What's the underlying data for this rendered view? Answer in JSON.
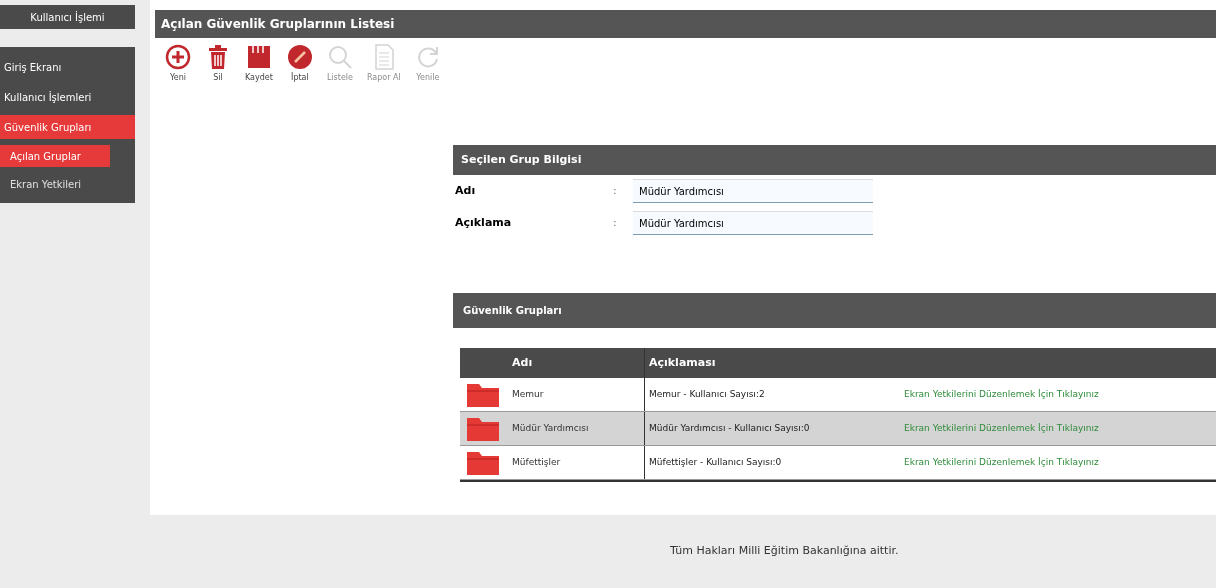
{
  "sidebar": {
    "header": "Kullanıcı İşlemi",
    "items": [
      {
        "label": "Giriş Ekranı",
        "selected": false
      },
      {
        "label": "Kullanıcı İşlemleri",
        "selected": false
      },
      {
        "label": "Güvenlik Grupları",
        "selected": true,
        "children": [
          {
            "label": "Açılan Gruplar",
            "selected": true
          },
          {
            "label": "Ekran Yetkileri",
            "selected": false
          }
        ]
      }
    ]
  },
  "page": {
    "title": "Açılan Güvenlik Gruplarının Listesi"
  },
  "toolbar": [
    {
      "kind": "add",
      "label": "Yeni",
      "disabled": false
    },
    {
      "kind": "delete",
      "label": "Sil",
      "disabled": false
    },
    {
      "kind": "save",
      "label": "Kaydet",
      "disabled": false
    },
    {
      "kind": "cancel",
      "label": "İptal",
      "disabled": false
    },
    {
      "kind": "search",
      "label": "Listele",
      "disabled": true
    },
    {
      "kind": "report",
      "label": "Rapor Al",
      "disabled": true
    },
    {
      "kind": "refresh",
      "label": "Yenile",
      "disabled": true
    }
  ],
  "selected_group": {
    "title": "Seçilen Grup Bilgisi",
    "fields": [
      {
        "label": "Adı",
        "separator": ":",
        "value": "Müdür Yardımcısı"
      },
      {
        "label": "Açıklama",
        "separator": ":",
        "value": "Müdür Yardımcısı"
      }
    ]
  },
  "groups": {
    "title": "Güvenlik Grupları",
    "columns": [
      "Adı",
      "Açıklaması"
    ],
    "rows": [
      {
        "name": "Memur",
        "description": "Memur - Kullanıcı Sayısı:2",
        "link": "Ekran Yetkilerini Düzenlemek İçin Tıklayınız",
        "selected": false
      },
      {
        "name": "Müdür Yardımcısı",
        "description": "Müdür Yardımcısı - Kullanıcı Sayısı:0",
        "link": "Ekran Yetkilerini Düzenlemek İçin Tıklayınız",
        "selected": true
      },
      {
        "name": "Müfettişler",
        "description": "Müfettişler - Kullanıcı Sayısı:0",
        "link": "Ekran Yetkilerini Düzenlemek İçin Tıklayınız",
        "selected": false
      }
    ]
  },
  "footer": "Tüm Hakları Milli Eğitim Bakanlığına aittir."
}
